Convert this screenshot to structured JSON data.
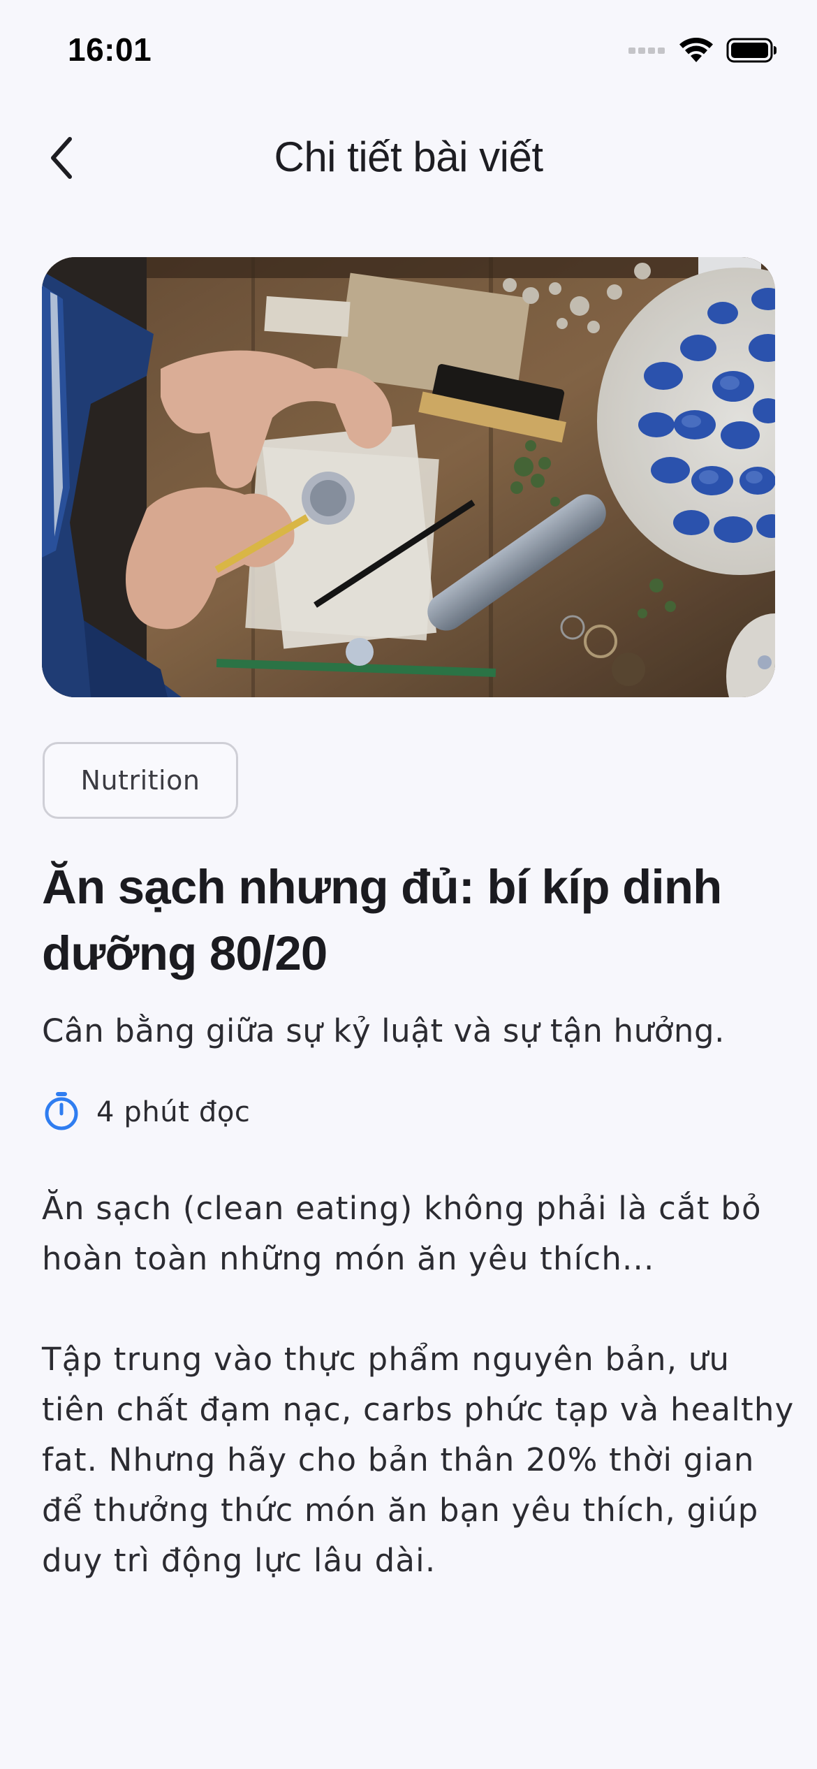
{
  "status_bar": {
    "time": "16:01",
    "icons": [
      "cellular-signal-icon",
      "wifi-icon",
      "battery-icon"
    ]
  },
  "nav": {
    "back_icon": "chevron-left-icon",
    "title": "Chi tiết bài viết"
  },
  "hero_image": {
    "description": "hands-crafting-wax-seals-photo"
  },
  "article": {
    "category": "Nutrition",
    "title": "Ăn sạch nhưng đủ: bí kíp dinh dưỡng 80/20",
    "subtitle": "Cân bằng giữa sự kỷ luật và sự tận hưởng.",
    "read_time_icon": "stopwatch-icon",
    "read_time": "4 phút đọc",
    "paragraphs": [
      "Ăn sạch (clean eating) không phải là cắt bỏ hoàn toàn những món ăn yêu thích...",
      "Tập trung vào thực phẩm nguyên bản, ưu tiên chất đạm nạc, carbs phức tạp và healthy fat. Nhưng hãy cho bản thân 20% thời gian để thưởng thức món ăn bạn yêu thích, giúp duy trì động lực lâu dài."
    ]
  },
  "colors": {
    "background": "#f7f7fc",
    "accent": "#2f7df0",
    "text": "#1d1d22"
  }
}
